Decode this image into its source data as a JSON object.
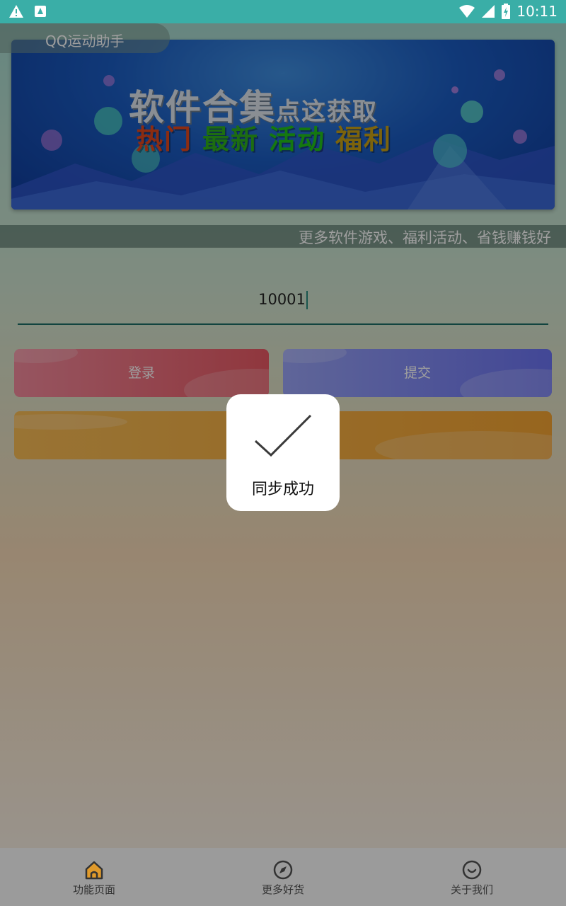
{
  "status_bar": {
    "time": "10:11",
    "left_icons": [
      "warning-icon",
      "app-notification-icon"
    ],
    "right_icons": [
      "wifi-icon",
      "cell-signal-icon",
      "battery-charging-icon"
    ],
    "bar_color": "#3aaea7"
  },
  "app": {
    "title": "QQ运动助手",
    "banner": {
      "headline": "软件合集",
      "headline_suffix": "点这获取",
      "tags": [
        {
          "text": "热门",
          "color": "#e3471c"
        },
        {
          "text": "最新",
          "color": "#2fb01c"
        },
        {
          "text": "活动",
          "color": "#22c21a"
        },
        {
          "text": "福利",
          "color": "#c9a114"
        }
      ]
    },
    "marquee_text": "更多软件游戏、福利活动、省钱赚钱好",
    "input": {
      "value": "10001"
    },
    "buttons": {
      "login_label": "登录",
      "submit_label": "提交",
      "wide_label": ""
    }
  },
  "toast": {
    "message": "同步成功"
  },
  "bottom_nav": {
    "items": [
      {
        "label": "功能页面",
        "icon": "home-icon",
        "active": true
      },
      {
        "label": "更多好货",
        "icon": "compass-icon",
        "active": false
      },
      {
        "label": "关于我们",
        "icon": "smiley-icon",
        "active": false
      }
    ]
  }
}
